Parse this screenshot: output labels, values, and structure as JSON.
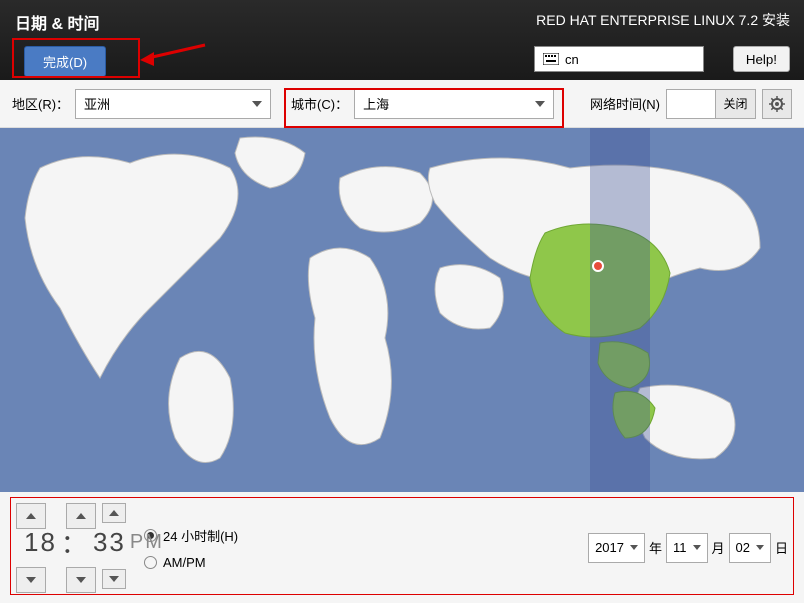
{
  "header": {
    "title": "日期 & 时间",
    "done_label": "完成(D)",
    "product": "RED HAT ENTERPRISE LINUX 7.2 安装",
    "keyboard": "cn",
    "help_label": "Help!"
  },
  "selectors": {
    "region_label": "地区(R)：",
    "region_value": "亚洲",
    "city_label": "城市(C)：",
    "city_value": "上海",
    "ntp_label": "网络时间(N)",
    "ntp_off": "关闭"
  },
  "time": {
    "hour": "18",
    "sep": "：",
    "minute": "33",
    "ampm": "PM",
    "fmt24_label": "24 小时制(H)",
    "fmt12_label": "AM/PM"
  },
  "date": {
    "year": "2017",
    "year_suffix": "年",
    "month": "11",
    "month_suffix": "月",
    "day": "02",
    "day_suffix": "日"
  }
}
